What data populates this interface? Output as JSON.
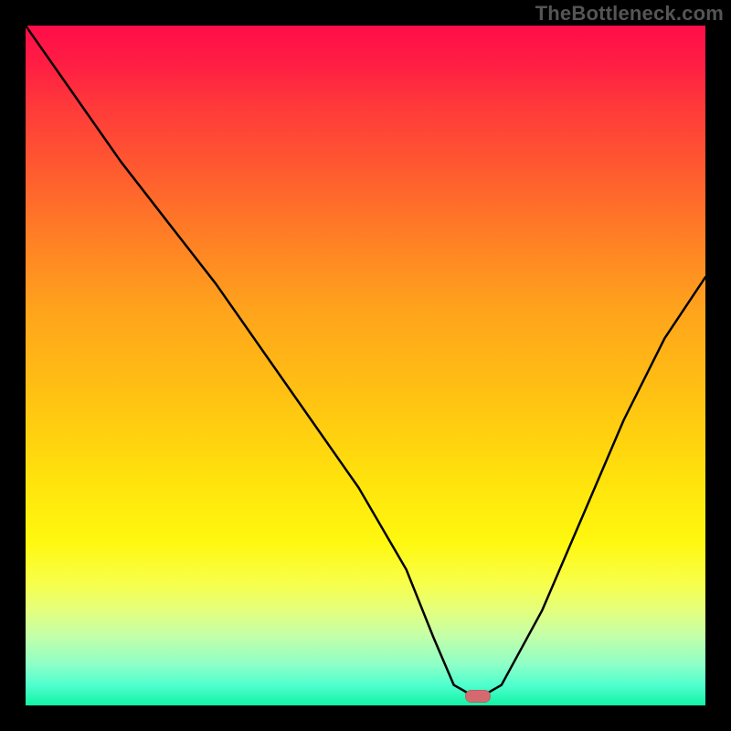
{
  "watermark": "TheBottleneck.com",
  "chart_data": {
    "type": "line",
    "title": "",
    "xlabel": "",
    "ylabel": "",
    "xlim": [
      0,
      1
    ],
    "ylim": [
      0,
      1
    ],
    "grid": false,
    "legend": false,
    "background_gradient": {
      "top": "#ff0d49",
      "mid": "#ffe30c",
      "bottom": "#12f3a5"
    },
    "series": [
      {
        "name": "bottleneck-curve",
        "x": [
          0.0,
          0.07,
          0.14,
          0.21,
          0.28,
          0.35,
          0.42,
          0.49,
          0.56,
          0.6,
          0.63,
          0.665,
          0.7,
          0.76,
          0.82,
          0.88,
          0.94,
          1.0
        ],
        "y": [
          1.0,
          0.9,
          0.8,
          0.71,
          0.62,
          0.52,
          0.42,
          0.32,
          0.2,
          0.1,
          0.03,
          0.01,
          0.03,
          0.14,
          0.28,
          0.42,
          0.54,
          0.63
        ]
      }
    ],
    "marker": {
      "x": 0.665,
      "y": 0.013,
      "color": "#d46a6f"
    }
  }
}
